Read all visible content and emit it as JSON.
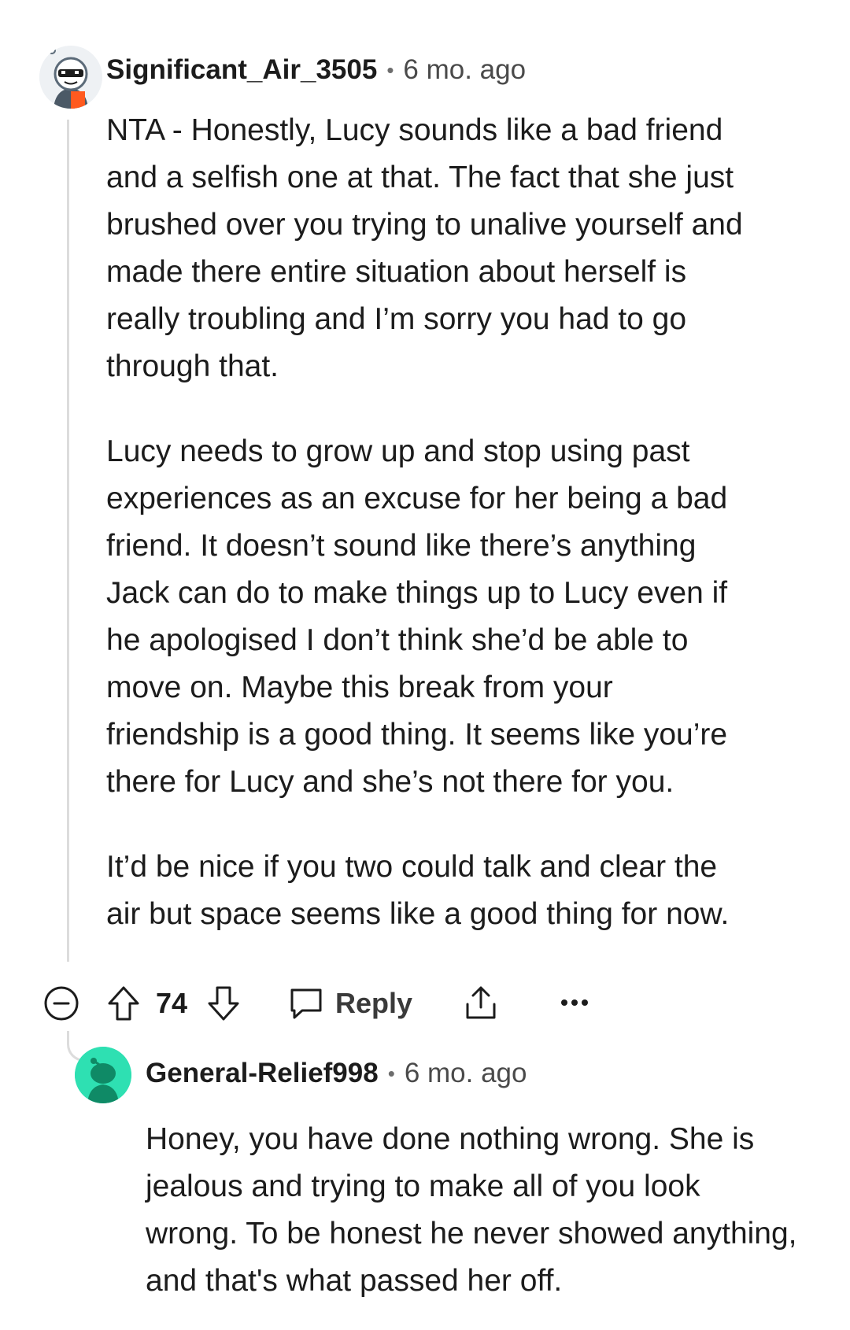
{
  "comment": {
    "username": "Significant_Air_3505",
    "separator": "•",
    "time": "6 mo. ago",
    "paragraphs": [
      "NTA - Honestly, Lucy sounds like a bad friend and a selfish one at that. The fact that she just brushed over you trying to unalive yourself and made there entire situation about herself is really troubling and I’m sorry you had to go through that.",
      "Lucy needs to grow up and stop using past experiences as an excuse for her being a bad friend. It doesn’t sound like there’s anything Jack can do to make things up to Lucy even if he apologised I don’t think she’d be able to move on. Maybe this break from your friendship is a good thing. It seems like you’re there for Lucy and she’s not there for you.",
      "It’d be nice if you two could talk and clear the air but space seems like a good thing for now."
    ],
    "votes": "74",
    "reply_label": "Reply",
    "icons": [
      "collapse-icon",
      "upvote-icon",
      "downvote-icon",
      "comment-bubble-icon",
      "share-icon",
      "more-options-icon"
    ]
  },
  "reply": {
    "username": "General-Relief998",
    "separator": "•",
    "time": "6 mo. ago",
    "paragraphs": [
      "Honey, you have done nothing wrong. She is jealous and trying to make all of you look wrong. To be honest he never showed anything, and that's what passed her off."
    ]
  },
  "colors": {
    "thread_line": "#dcdcdc",
    "reply_avatar": "#2ee0b2",
    "text": "#1c1c1c",
    "muted": "#4a4a4a"
  }
}
